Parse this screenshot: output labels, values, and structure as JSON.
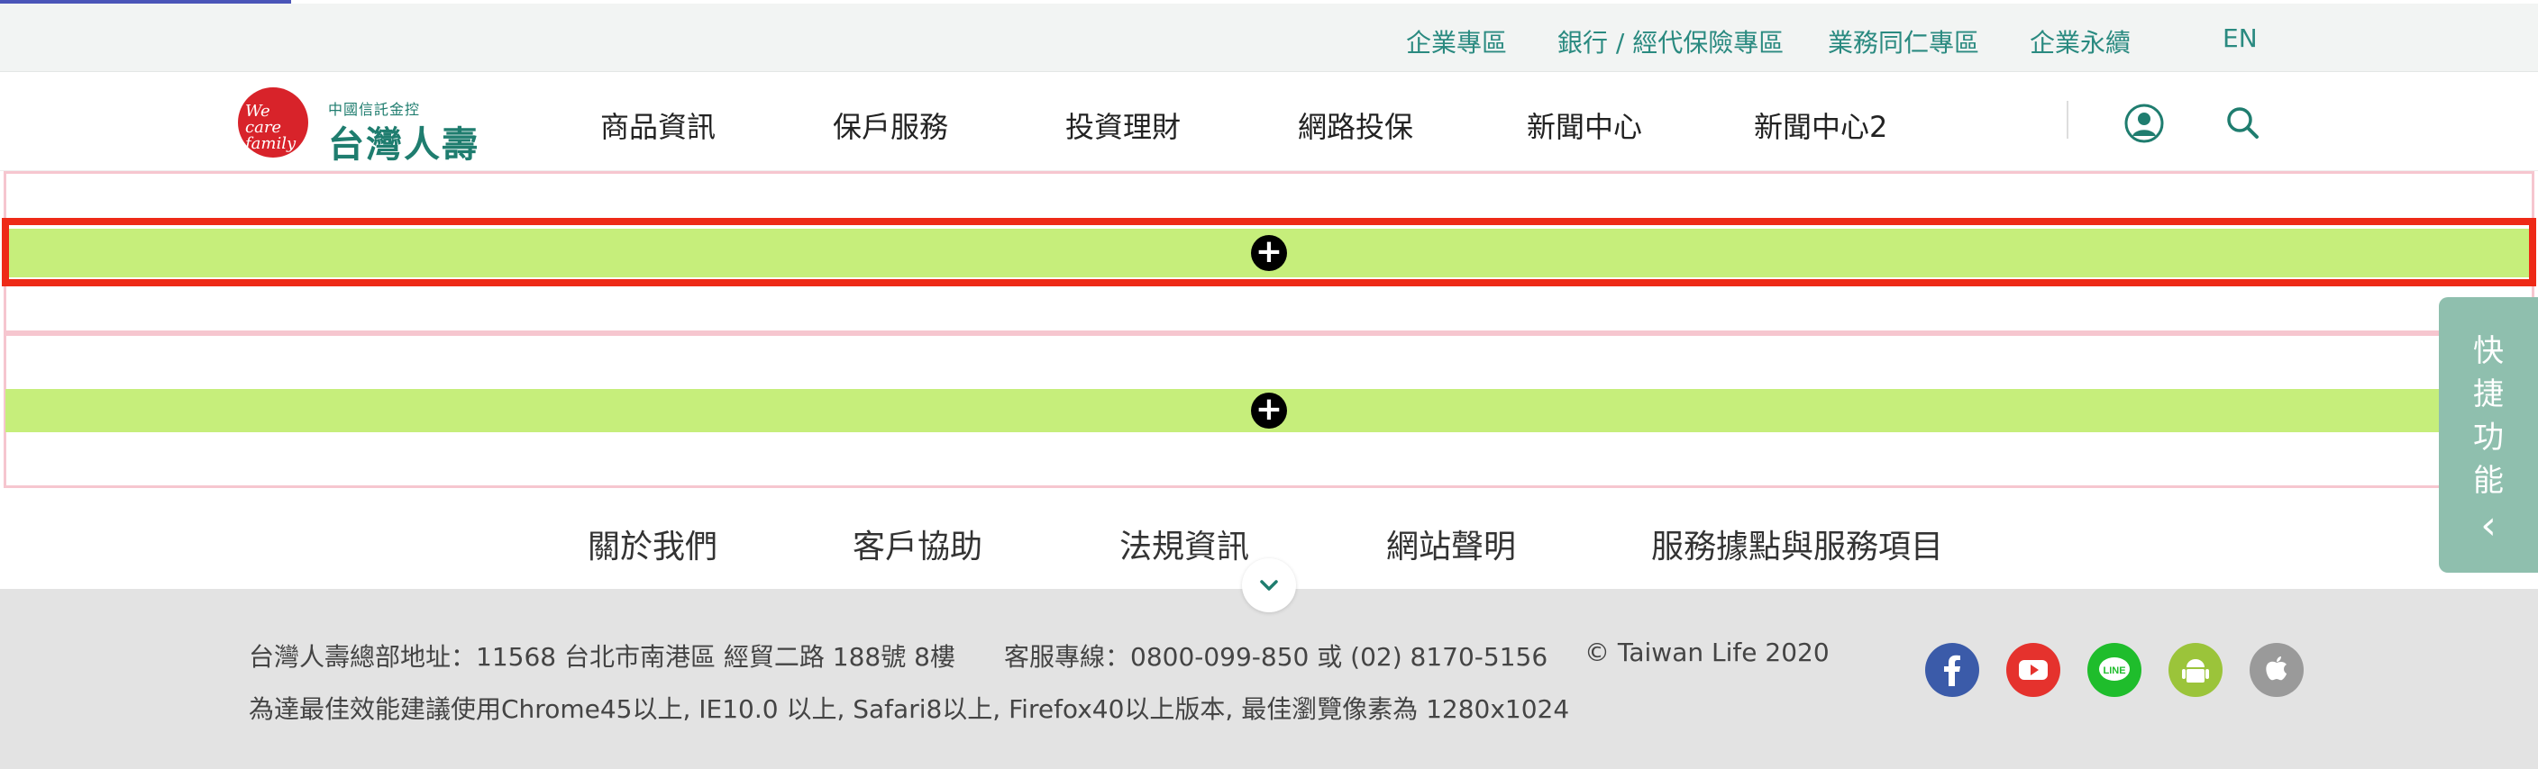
{
  "topbar": {
    "links": [
      "企業專區",
      "銀行 / 經代保險專區",
      "業務同仁專區",
      "企業永續",
      "EN"
    ]
  },
  "logo": {
    "tagline": "We care family",
    "small": "中國信託金控",
    "name": "台灣人壽"
  },
  "nav": {
    "items": [
      "商品資訊",
      "保戶服務",
      "投資理財",
      "網路投保",
      "新聞中心",
      "新聞中心2"
    ]
  },
  "content": {
    "add_symbol": "+"
  },
  "footer_links": [
    "關於我們",
    "客戶協助",
    "法規資訊",
    "網站聲明",
    "服務據點與服務項目"
  ],
  "footer": {
    "address": "台灣人壽總部地址：11568 台北市南港區 經貿二路 188號 8樓",
    "hotline": "客服專線：0800-099-850 或 (02) 8170-5156",
    "copyright": "© Taiwan Life 2020",
    "browser_note": "為達最佳效能建議使用Chrome45以上, IE10.0 以上, Safari8以上, Firefox40以上版本, 最佳瀏覽像素為 1280x1024"
  },
  "social": [
    {
      "name": "facebook-icon",
      "color": "#3b5ba9"
    },
    {
      "name": "youtube-icon",
      "color": "#e5322d"
    },
    {
      "name": "line-icon",
      "color": "#1fbd2c"
    },
    {
      "name": "android-icon",
      "color": "#9bc43a"
    },
    {
      "name": "apple-icon",
      "color": "#9a9a9a"
    }
  ],
  "quick_panel": {
    "chars": [
      "快",
      "捷",
      "功",
      "能"
    ],
    "collapse": "‹"
  },
  "colors": {
    "brand_green": "#1f7d6f",
    "bar_green": "#c6ee7b",
    "highlight_red": "#ee2a17",
    "quick_panel": "#8fbfae"
  }
}
